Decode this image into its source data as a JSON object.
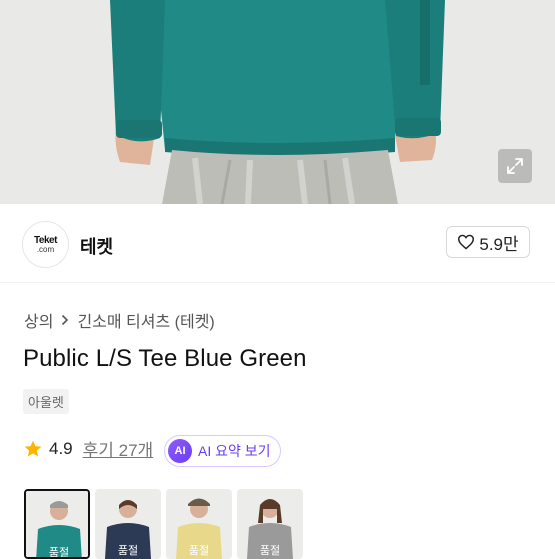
{
  "hero": {
    "expand_icon": "expand-icon"
  },
  "seller": {
    "logo_line1": "Teket",
    "logo_line2": ".com",
    "name": "테켓",
    "likes": "5.9만",
    "heart_icon": "heart-outline-icon"
  },
  "breadcrumb": {
    "items": [
      "상의",
      "긴소매 티셔츠 (테켓)"
    ],
    "separator_icon": "chevron-right-icon"
  },
  "product": {
    "title": "Public L/S Tee Blue Green",
    "tag": "아울렛",
    "rating": "4.9",
    "review_label": "후기 27개",
    "ai_badge": "AI",
    "ai_label": "AI 요약 보기"
  },
  "thumbnails": [
    {
      "label": "품절",
      "color": "#1f8a86",
      "active": true
    },
    {
      "label": "품절",
      "color": "#2c3a55",
      "active": false
    },
    {
      "label": "품절",
      "color": "#e8d98a",
      "active": false
    },
    {
      "label": "품절",
      "color": "#9a9a9a",
      "active": false
    }
  ],
  "colors": {
    "star": "#ffb400",
    "ai_accent": "#6b3df0",
    "sweater": "#1f8a86"
  }
}
